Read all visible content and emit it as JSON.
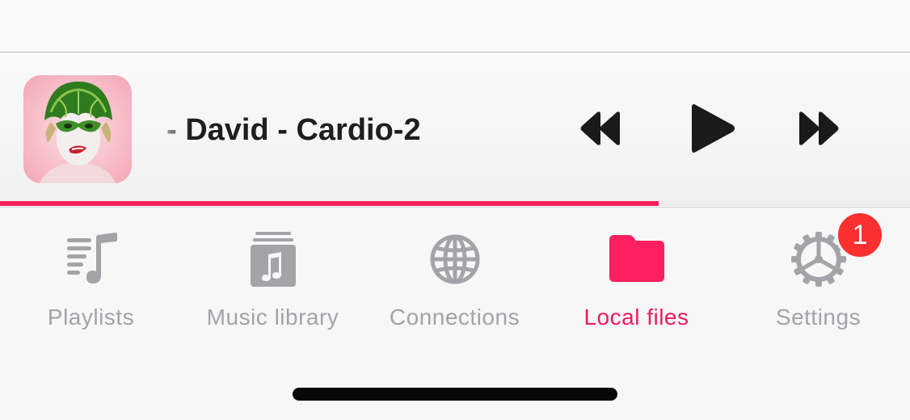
{
  "player": {
    "track_title": "- David - Cardio-2",
    "progress_fraction": 0.724,
    "accent_color": "#fd1f5f",
    "controls": {
      "rewind_icon": "rewind-icon",
      "play_icon": "play-icon",
      "fast_forward_icon": "fast-forward-icon"
    }
  },
  "tabs": [
    {
      "label": "Playlists",
      "icon": "playlists-icon",
      "active": false
    },
    {
      "label": "Music library",
      "icon": "music-library-icon",
      "active": false
    },
    {
      "label": "Connections",
      "icon": "globe-icon",
      "active": false
    },
    {
      "label": "Local files",
      "icon": "folder-icon",
      "active": true
    },
    {
      "label": "Settings",
      "icon": "gear-icon",
      "active": false
    }
  ],
  "settings_badge": "1",
  "colors": {
    "active_tab": "#f21a5c",
    "inactive_tab": "#a3a3a8",
    "badge": "#fb3030"
  }
}
